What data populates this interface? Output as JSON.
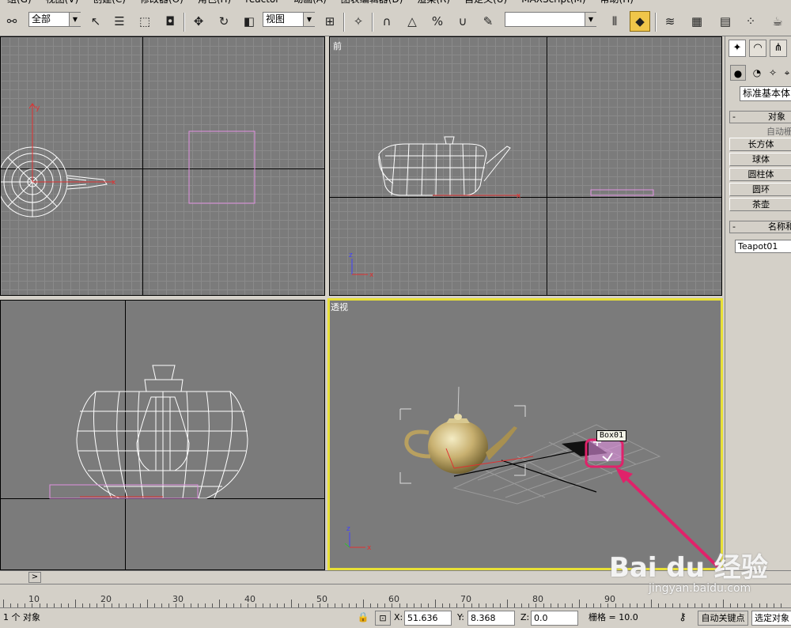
{
  "menu": [
    "组(G)",
    "视图(V)",
    "创建(C)",
    "修改器(O)",
    "角色(H)",
    "reactor",
    "动画(A)",
    "图表编辑器(D)",
    "渲染(R)",
    "自定义(U)",
    "MAXScript(M)",
    "帮助(H)"
  ],
  "toolbar": {
    "selection_filter": "全部",
    "reference_coord": "视图",
    "named_selection": ""
  },
  "viewports": {
    "top_left": {
      "label": ""
    },
    "front": {
      "label": "前"
    },
    "left": {
      "label": ""
    },
    "perspective": {
      "label": "透视",
      "tooltip": "Box01"
    }
  },
  "command_panel": {
    "category_dropdown": "标准基本体",
    "object_type_header": "对象",
    "autogrid_label": "自动栅",
    "buttons": [
      "长方体",
      "球体",
      "圆柱体",
      "圆环",
      "茶壶"
    ],
    "name_color_header": "名称和",
    "name_value": "Teapot01"
  },
  "timeline": {
    "slider_arrow": ">",
    "ruler_ticks": [
      "10",
      "20",
      "30",
      "40",
      "50",
      "60",
      "70",
      "80",
      "90"
    ]
  },
  "status": {
    "selection_count": "1 个 对象",
    "x_label": "X:",
    "x_value": "51.636",
    "y_label": "Y:",
    "y_value": "8.368",
    "z_label": "Z:",
    "z_value": "0.0",
    "grid": "栅格 = 10.0",
    "autokey": "自动关键点",
    "selected": "选定对象"
  },
  "watermark": {
    "brand": "Bai du 经验",
    "url": "jingyan.baidu.com"
  },
  "colors": {
    "viewport_bg": "#7b7b7b",
    "active_border": "#e8e035",
    "annotation": "#e0226a",
    "selection_pink": "#e090e0"
  }
}
